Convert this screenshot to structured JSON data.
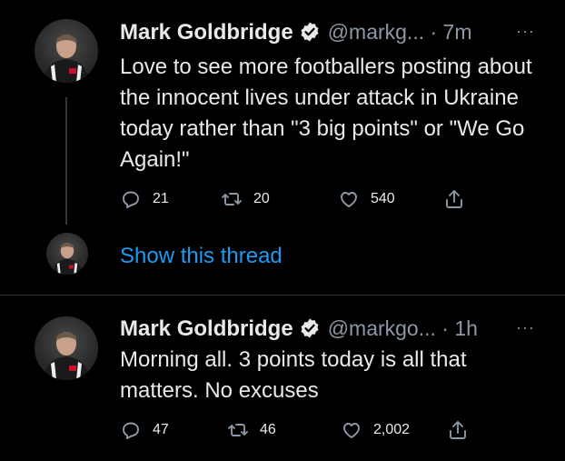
{
  "tweets": [
    {
      "name": "Mark Goldbridge",
      "handle": "@markg... · 7m",
      "text": "Love to see more footballers posting about the innocent lives under attack in Ukraine today rather than \"3 big points\" or \"We Go Again!\"",
      "replies": "21",
      "retweets": "20",
      "likes": "540"
    },
    {
      "name": "Mark Goldbridge",
      "handle": "@markgo... · 1h",
      "text": "Morning all. 3 points today is all that matters. No excuses",
      "replies": "47",
      "retweets": "46",
      "likes": "2,002"
    }
  ],
  "thread": {
    "show_label": "Show this thread"
  },
  "more_label": "···",
  "icons": {
    "reply": "reply-icon",
    "retweet": "retweet-icon",
    "like": "heart-icon",
    "share": "share-icon",
    "verified": "verified-badge-icon",
    "more": "more-icon"
  },
  "colors": {
    "background": "#000000",
    "text": "#e7e9ea",
    "muted": "#8b98a5",
    "link": "#1d9bf0"
  }
}
